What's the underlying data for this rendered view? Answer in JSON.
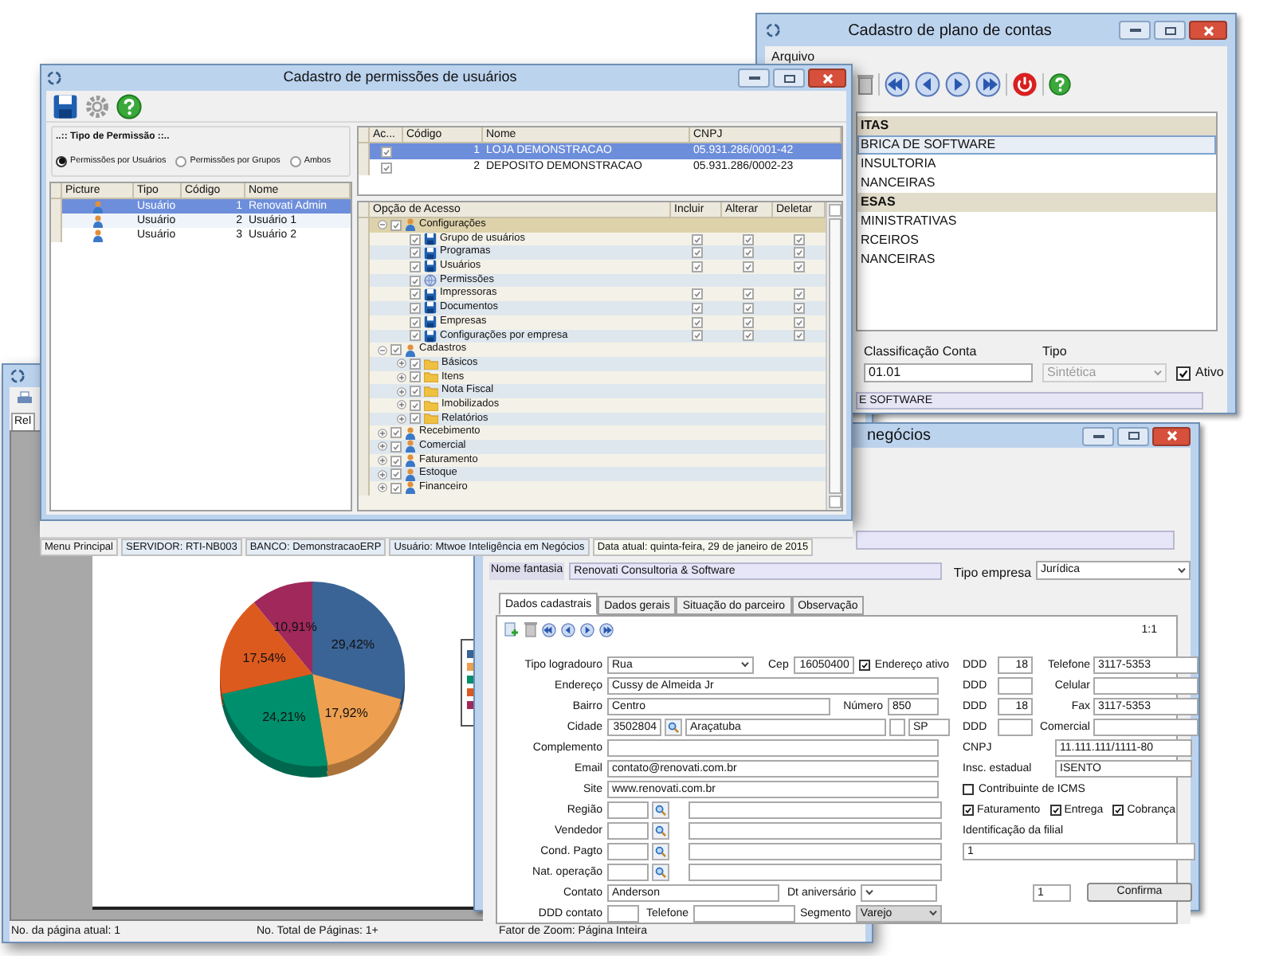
{
  "report_window": {
    "tab": "Rel",
    "chart_data": {
      "type": "pie",
      "values": [
        29.42,
        17.92,
        24.21,
        17.54,
        10.91
      ],
      "colors": [
        "#3a6496",
        "#eea050",
        "#008f6c",
        "#dd5a1e",
        "#a0285a"
      ],
      "value_labels": [
        "29,42%",
        "17,92%",
        "24,21%",
        "17,54%",
        "10,91%"
      ]
    },
    "status": [
      "No. da página atual: 1",
      "No. Total de Páginas: 1+",
      "Fator de Zoom: Página Inteira"
    ]
  },
  "plan_window": {
    "title": "Cadastro de plano de contas",
    "menu": [
      "Arquivo"
    ],
    "accounts": [
      {
        "name": "ITAS",
        "kind": "group",
        "selected": false
      },
      {
        "name": "BRICA DE SOFTWARE",
        "kind": "account",
        "selected": true
      },
      {
        "name": "INSULTORIA",
        "kind": "account",
        "selected": false
      },
      {
        "name": "NANCEIRAS",
        "kind": "account",
        "selected": false
      },
      {
        "name": "ESAS",
        "kind": "group",
        "selected": false
      },
      {
        "name": "MINISTRATIVAS",
        "kind": "account",
        "selected": false
      },
      {
        "name": "RCEIROS",
        "kind": "account",
        "selected": false
      },
      {
        "name": "NANCEIRAS",
        "kind": "account",
        "selected": false
      }
    ],
    "class_label": "Classificação Conta",
    "class_value": "01.01",
    "type_label": "Tipo",
    "type_value": "Sintética",
    "type_disabled": true,
    "active_label": "Ativo",
    "active": true,
    "description": "E SOFTWARE"
  },
  "business_window": {
    "title": "negócios",
    "nome_fantasia_label": "Nome fantasia",
    "nome_fantasia": "Renovati Consultoria & Software",
    "tipo_empresa_label": "Tipo empresa",
    "tipo_empresa": "Jurídica",
    "tabs": [
      {
        "label": "Dados cadastrais",
        "selected": true
      },
      {
        "label": "Dados gerais",
        "selected": false
      },
      {
        "label": "Situação do parceiro",
        "selected": false
      },
      {
        "label": "Observação",
        "selected": false
      }
    ],
    "page": "1:1",
    "form": {
      "tipo_logradouro": {
        "label": "Tipo logradouro",
        "value": "Rua"
      },
      "cep": {
        "label": "Cep",
        "value": "16050400"
      },
      "endereco_ativo": {
        "label": "Endereço ativo",
        "checked": true
      },
      "endereco": {
        "label": "Endereço",
        "value": "Cussy de Almeida Jr"
      },
      "bairro": {
        "label": "Bairro",
        "value": "Centro"
      },
      "numero": {
        "label": "Número",
        "value": "850"
      },
      "cidade": {
        "label": "Cidade",
        "code": "3502804",
        "name": "Araçatuba",
        "uf": "SP"
      },
      "complemento": {
        "label": "Complemento"
      },
      "email": {
        "label": "Email",
        "value": "contato@renovati.com.br"
      },
      "site": {
        "label": "Site",
        "value": "www.renovati.com.br"
      },
      "lookups": [
        {
          "label": "Região"
        },
        {
          "label": "Vendedor"
        },
        {
          "label": "Cond. Pagto"
        },
        {
          "label": "Nat. operação"
        }
      ],
      "contato": {
        "label": "Contato",
        "value": "Anderson"
      },
      "dt_aniversario": {
        "label": "Dt aniversário"
      },
      "ddd_contato": {
        "label": "DDD contato"
      },
      "telefone": {
        "label": "Telefone"
      },
      "segmento": {
        "label": "Segmento",
        "value": "Varejo"
      },
      "phones": [
        {
          "ddd_label": "DDD",
          "ddd": "18",
          "label": "Telefone",
          "value": "3117-5353"
        },
        {
          "ddd_label": "DDD",
          "label": "Celular"
        },
        {
          "ddd_label": "DDD",
          "ddd": "18",
          "label": "Fax",
          "value": "3117-5353"
        },
        {
          "ddd_label": "DDD",
          "label": "Comercial"
        }
      ],
      "cnpj": {
        "label": "CNPJ",
        "value": "11.111.111/1111-80"
      },
      "ie": {
        "label": "Insc. estadual",
        "value": "ISENTO"
      },
      "icms": {
        "label": "Contribuinte de ICMS",
        "checked": false
      },
      "flags": [
        {
          "label": "Faturamento",
          "checked": true
        },
        {
          "label": "Entrega",
          "checked": true
        },
        {
          "label": "Cobrança",
          "checked": true
        }
      ],
      "filial": {
        "label": "Identificação da filial",
        "value": "1"
      },
      "counter": "1",
      "confirm": "Confirma"
    }
  },
  "permissions_window": {
    "title": "Cadastro de permissões de usuários",
    "group_title": "..:: Tipo de Permissão ::..",
    "radios": [
      {
        "label": "Permissões por Usuários",
        "selected": true
      },
      {
        "label": "Permissões por Grupos",
        "selected": false
      },
      {
        "label": "Ambos",
        "selected": false
      }
    ],
    "users_columns": [
      "Picture",
      "Tipo",
      "Código",
      "Nome"
    ],
    "users": [
      {
        "tipo": "Usuário",
        "codigo": "1",
        "nome": "Renovati Admin",
        "selected": true
      },
      {
        "tipo": "Usuário",
        "codigo": "2",
        "nome": "Usuário 1",
        "selected": false
      },
      {
        "tipo": "Usuário",
        "codigo": "3",
        "nome": "Usuário 2",
        "selected": false
      }
    ],
    "companies_columns": [
      "Ac...",
      "Código",
      "Nome",
      "CNPJ"
    ],
    "companies": [
      {
        "checked": true,
        "codigo": "1",
        "nome": "LOJA DEMONSTRACAO",
        "cnpj": "05.931.286/0001-42",
        "selected": true
      },
      {
        "checked": true,
        "codigo": "2",
        "nome": "DEPOSITO DEMONSTRACAO",
        "cnpj": "05.931.286/0002-23",
        "selected": false
      }
    ],
    "access_columns": [
      "Opção de Acesso",
      "Incluir",
      "Alterar",
      "Deletar"
    ],
    "access_tree": [
      {
        "label": "Configurações",
        "kind": "user",
        "checked": true,
        "expanded": true,
        "selected": true,
        "children": [
          {
            "label": "Grupo de usuários",
            "kind": "form",
            "checked": true,
            "selected": false,
            "rights": [
              true,
              true,
              true
            ]
          },
          {
            "label": "Programas",
            "kind": "form",
            "checked": true,
            "selected": false,
            "rights": [
              true,
              true,
              true
            ]
          },
          {
            "label": "Usuários",
            "kind": "form",
            "checked": true,
            "selected": false,
            "rights": [
              true,
              true,
              true
            ]
          },
          {
            "label": "Permissões",
            "kind": "globe",
            "checked": true,
            "selected": false
          },
          {
            "label": "Impressoras",
            "kind": "form",
            "checked": true,
            "selected": false,
            "rights": [
              true,
              true,
              true
            ]
          },
          {
            "label": "Documentos",
            "kind": "form",
            "checked": true,
            "selected": false,
            "rights": [
              true,
              true,
              true
            ]
          },
          {
            "label": "Empresas",
            "kind": "form",
            "checked": true,
            "selected": false,
            "rights": [
              true,
              true,
              true
            ]
          },
          {
            "label": "Configurações por empresa",
            "kind": "form",
            "checked": true,
            "selected": false,
            "rights": [
              true,
              true,
              true
            ]
          }
        ]
      },
      {
        "label": "Cadastros",
        "kind": "user",
        "checked": true,
        "expanded": true,
        "selected": false,
        "children": [
          {
            "label": "Básicos",
            "kind": "folder",
            "checked": true,
            "expanded": false,
            "selected": false
          },
          {
            "label": "Itens",
            "kind": "folder",
            "checked": true,
            "expanded": false,
            "selected": false
          },
          {
            "label": "Nota Fiscal",
            "kind": "folder",
            "checked": true,
            "expanded": false,
            "selected": false
          },
          {
            "label": "Imobilizados",
            "kind": "folder",
            "checked": true,
            "expanded": false,
            "selected": false
          },
          {
            "label": "Relatórios",
            "kind": "folder",
            "checked": true,
            "expanded": false,
            "selected": false
          }
        ]
      },
      {
        "label": "Recebimento",
        "kind": "user",
        "checked": true,
        "expanded": false,
        "selected": false
      },
      {
        "label": "Comercial",
        "kind": "user",
        "checked": true,
        "expanded": false,
        "selected": false
      },
      {
        "label": "Faturamento",
        "kind": "user",
        "checked": true,
        "expanded": false,
        "selected": false
      },
      {
        "label": "Estoque",
        "kind": "user",
        "checked": true,
        "expanded": false,
        "selected": false
      },
      {
        "label": "Financeiro",
        "kind": "user",
        "checked": true,
        "expanded": false,
        "selected": false
      }
    ]
  },
  "status_bar": [
    "Menu Principal",
    "SERVIDOR: RTI-NB003",
    "BANCO: DemonstracaoERP",
    "Usuário: Mtwoe Inteligência em Negócios",
    "Data atual: quinta-feira, 29 de janeiro de 2015"
  ]
}
